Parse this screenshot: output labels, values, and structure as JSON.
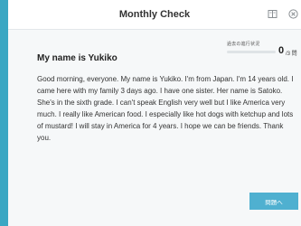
{
  "window": {
    "title": "Monthly Check"
  },
  "icons": {
    "book": "book-icon",
    "close": "close-icon"
  },
  "progress": {
    "label": "過去の進行状況",
    "current": "0",
    "total": "/3 問",
    "fraction": 0
  },
  "passage": {
    "heading": "My name is Yukiko",
    "text": "Good morning, everyone. My name is Yukiko. I'm from Japan. I'm 14 years old. I came here with my family 3 days ago. I have one sister. Her name is Satoko. She's in the sixth grade. I can't speak English very well but I like America very much. I really like American food. I especially like hot dogs with ketchup and lots of mustard! I will stay in America for 4 years. I hope we can be friends. Thank you."
  },
  "actions": {
    "next_label": "問題へ"
  },
  "colors": {
    "accent": "#3aa7c3",
    "button": "#4fb0d0",
    "background": "#f6f8f9"
  }
}
